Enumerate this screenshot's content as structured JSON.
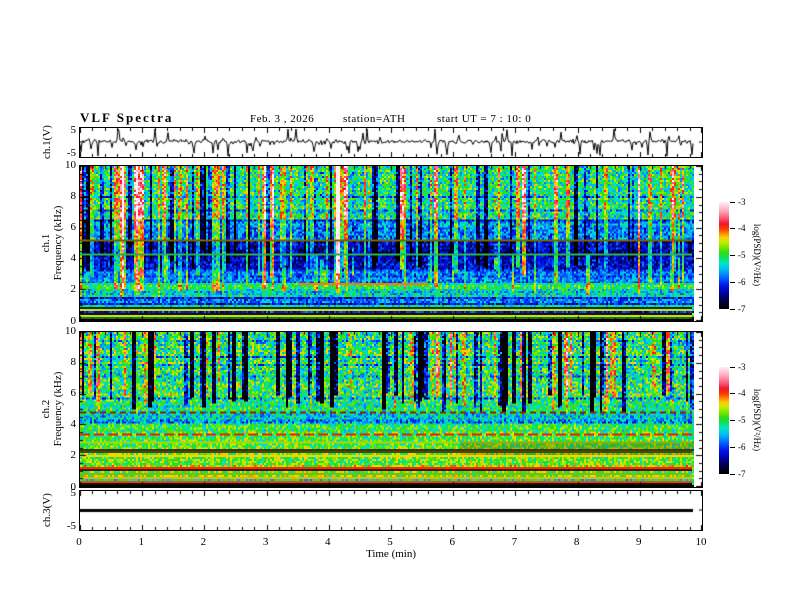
{
  "header": {
    "title": "VLF  Spectra",
    "date": "Feb. 3  , 2026",
    "station": "station=ATH",
    "start_ut": "start UT  =   7  : 10: 0"
  },
  "chart_data": {
    "type": "heatmap",
    "subtype": "vlf-multipanel-spectrogram",
    "title": "VLF Spectra",
    "date": "Feb. 3 , 2026",
    "station": "ATH",
    "start_ut": "7:10:0",
    "time_axis": {
      "label": "Time  (min)",
      "ticks": [
        "0",
        "1",
        "2",
        "3",
        "4",
        "5",
        "6",
        "7",
        "8",
        "9",
        "10"
      ],
      "range": [
        0,
        10
      ],
      "minor_step": 0.2,
      "data_end_min": 9.85
    },
    "colormap": {
      "range": [
        -7,
        -3
      ],
      "stops": [
        [
          0.0,
          "#000000"
        ],
        [
          0.07,
          "#000040"
        ],
        [
          0.14,
          "#0000a0"
        ],
        [
          0.22,
          "#0018f0"
        ],
        [
          0.3,
          "#0070ff"
        ],
        [
          0.37,
          "#00c0f0"
        ],
        [
          0.43,
          "#00e8c0"
        ],
        [
          0.48,
          "#10e060"
        ],
        [
          0.53,
          "#30dd10"
        ],
        [
          0.58,
          "#80e800"
        ],
        [
          0.63,
          "#c8ee00"
        ],
        [
          0.67,
          "#ffcc00"
        ],
        [
          0.71,
          "#ff8800"
        ],
        [
          0.75,
          "#ff3c00"
        ],
        [
          0.8,
          "#ee1830"
        ],
        [
          0.86,
          "#ff6080"
        ],
        [
          0.92,
          "#ffa8bc"
        ],
        [
          1.0,
          "#ffeef2"
        ]
      ]
    },
    "colorbar": {
      "label": "log(PSD)(V²/Hz)",
      "ticks": [
        "-3",
        "-4",
        "-5",
        "-6",
        "-7"
      ]
    },
    "panels": {
      "ch1_wave": {
        "kind": "waveform",
        "ylabel": "ch.1(V)",
        "ytick_top": "5",
        "ytick_bottom": "-5",
        "yrange": [
          -5,
          5
        ],
        "baseline": 0.4,
        "noise_sd": 0.35,
        "spike_count": 130,
        "spike_max": 4.4,
        "negative_fraction": 0.62,
        "seed": 33
      },
      "ch1_spec": {
        "kind": "spectrogram",
        "ylabel_channel": "ch.1",
        "ylabel_axis": "Frequency (kHz)",
        "yticks": [
          "0",
          "2",
          "4",
          "6",
          "8",
          "10"
        ],
        "yrange_khz": [
          0,
          10
        ],
        "seed": 11,
        "bands": [
          [
            0.0,
            0.2,
            -7.0,
            0.15
          ],
          [
            0.2,
            0.5,
            -4.65,
            0.55
          ],
          [
            0.5,
            0.62,
            -6.3,
            0.4
          ],
          [
            0.62,
            0.82,
            -4.8,
            0.5
          ],
          [
            0.82,
            1.05,
            -5.3,
            0.45
          ],
          [
            1.05,
            1.55,
            -5.75,
            0.45
          ],
          [
            1.55,
            2.1,
            -5.35,
            0.5
          ],
          [
            2.1,
            2.45,
            -5.05,
            0.45
          ],
          [
            2.45,
            3.3,
            -5.85,
            0.45
          ],
          [
            3.3,
            5.2,
            -6.35,
            0.45
          ],
          [
            5.2,
            6.5,
            -5.7,
            0.5
          ],
          [
            6.5,
            10.0,
            -5.15,
            0.6
          ]
        ],
        "streaks": {
          "bright": {
            "count": 80,
            "amp": [
              0.6,
              1.3
            ],
            "f_start": [
              1.5,
              3.5
            ],
            "width": [
              1,
              2.5
            ]
          },
          "dark": {
            "count": 45,
            "amp": [
              -1.5,
              -0.7
            ],
            "f_start": [
              3.2,
              4.8
            ],
            "width": [
              1,
              2
            ]
          }
        },
        "row_dark": {
          "prob": 0.06,
          "amp": -0.5
        },
        "hlines": [
          [
            5.3,
            "#7a6200",
            1,
            null,
            null
          ],
          [
            4.35,
            "#2ab04a",
            1,
            null,
            null
          ],
          [
            2.44,
            "#ff7700",
            1,
            [
              3.5,
              5.6
            ],
            null
          ],
          [
            0.95,
            "#0a3a0a",
            1,
            null,
            null
          ],
          [
            0.72,
            "#d8d800",
            1,
            null,
            null
          ],
          [
            0.55,
            "#15150a",
            1,
            null,
            null
          ],
          [
            0.4,
            "#c8e000",
            1,
            null,
            null
          ],
          [
            0.28,
            "#207020",
            1,
            null,
            null
          ]
        ],
        "overlays": []
      },
      "ch2_spec": {
        "kind": "spectrogram",
        "ylabel_channel": "ch.2",
        "ylabel_axis": "Frequency (kHz)",
        "yticks": [
          "0",
          "2",
          "4",
          "6",
          "8",
          "10"
        ],
        "yrange_khz": [
          0,
          10
        ],
        "seed": 22,
        "bands": [
          [
            0.0,
            0.18,
            -7.0,
            0.15
          ],
          [
            0.18,
            0.45,
            -4.8,
            0.5
          ],
          [
            0.45,
            0.7,
            -4.55,
            0.5
          ],
          [
            0.7,
            1.15,
            -4.85,
            0.5
          ],
          [
            1.15,
            1.35,
            -4.5,
            0.55
          ],
          [
            1.35,
            2.2,
            -4.85,
            0.5
          ],
          [
            2.2,
            2.5,
            -5.6,
            0.7
          ],
          [
            2.5,
            3.35,
            -4.9,
            0.5
          ],
          [
            3.35,
            3.55,
            -4.75,
            0.6
          ],
          [
            3.55,
            4.05,
            -5.05,
            0.5
          ],
          [
            4.05,
            4.4,
            -5.8,
            0.55
          ],
          [
            4.4,
            4.7,
            -5.35,
            0.5
          ],
          [
            4.7,
            5.5,
            -5.1,
            0.55
          ],
          [
            5.5,
            10.0,
            -5.0,
            0.7
          ]
        ],
        "streaks": {
          "bright": {
            "count": 40,
            "amp": [
              0.5,
              1.1
            ],
            "f_start": [
              4.5,
              6.5
            ],
            "width": [
              1,
              2
            ]
          },
          "dark": {
            "count": 65,
            "amp": [
              -2.4,
              -1.0
            ],
            "f_start": [
              4.8,
              6.0
            ],
            "width": [
              1,
              2.5
            ]
          }
        },
        "row_dark": {
          "prob": 0.06,
          "amp": -0.5
        },
        "hlines": [
          [
            4.85,
            "#8a2a00",
            1,
            null,
            [
              3,
              2
            ]
          ],
          [
            3.45,
            "#ee2200",
            1,
            null,
            [
              5,
              2
            ]
          ],
          [
            3.0,
            "#a8d800",
            1,
            null,
            null
          ],
          [
            2.4,
            "#3a3a00",
            1,
            null,
            null
          ],
          [
            2.28,
            "#4a4a10",
            1,
            null,
            null
          ],
          [
            2.06,
            "#ffd000",
            1,
            null,
            null
          ],
          [
            1.25,
            "#ee3300",
            1,
            null,
            null
          ],
          [
            1.1,
            "#5a1000",
            1,
            null,
            null
          ],
          [
            0.85,
            "#88bb00",
            1,
            null,
            null
          ],
          [
            0.62,
            "#ffaa00",
            1,
            null,
            null
          ],
          [
            0.4,
            "#ee4400",
            1,
            null,
            null
          ],
          [
            0.22,
            "#181800",
            1,
            null,
            null
          ]
        ],
        "overlays": [
          [
            6.1,
            9.85,
            2.05,
            3.0,
            "rgba(90,70,0,0.28)"
          ]
        ]
      },
      "ch3_wave": {
        "kind": "flatline",
        "ylabel": "ch.3(V)",
        "ytick_top": "5",
        "ytick_bottom": "-5",
        "yrange": [
          -5,
          5
        ],
        "value": 0,
        "line_width": 3
      }
    }
  }
}
